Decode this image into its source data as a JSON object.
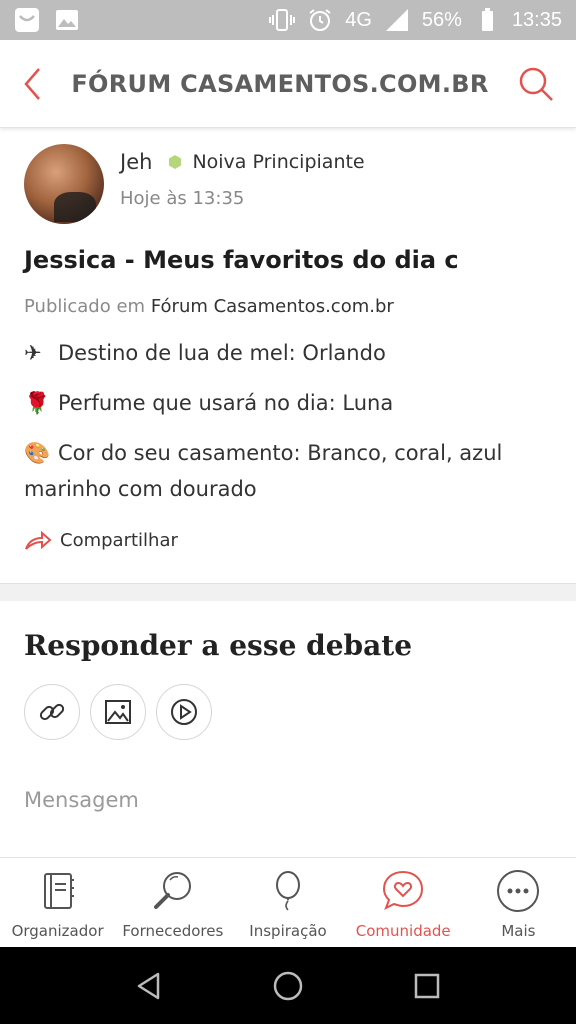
{
  "status_bar": {
    "network": "4G",
    "battery": "56%",
    "time": "13:35"
  },
  "header": {
    "title": "FÓRUM CASAMENTOS.COM.BR",
    "back_icon": "chevron-left-icon",
    "search_icon": "search-icon"
  },
  "post": {
    "author": "Jeh",
    "badge": "Noiva Principiante",
    "time": "Hoje às 13:35",
    "title": "Jessica - Meus favoritos do dia c",
    "published_prefix": "Publicado em",
    "published_forum": "Fórum Casamentos.com.br",
    "lines": [
      {
        "emoji": "✈",
        "text": "Destino de lua de mel: Orlando"
      },
      {
        "emoji": "🌹",
        "text": "Perfume que usará no dia: Luna"
      },
      {
        "emoji": "🎨",
        "text": "Cor do seu casamento: Branco, coral, azul marinho com dourado"
      }
    ],
    "share_label": "Compartilhar"
  },
  "reply": {
    "title": "Responder a esse debate",
    "tools": [
      "link-icon",
      "image-icon",
      "video-icon"
    ],
    "message_placeholder": "Mensagem"
  },
  "bottom_nav": {
    "items": [
      {
        "label": "Organizador",
        "icon": "notebook-icon",
        "active": false
      },
      {
        "label": "Fornecedores",
        "icon": "magnifier-icon",
        "active": false
      },
      {
        "label": "Inspiração",
        "icon": "balloon-icon",
        "active": false
      },
      {
        "label": "Comunidade",
        "icon": "chat-heart-icon",
        "active": true
      },
      {
        "label": "Mais",
        "icon": "more-icon",
        "active": false
      }
    ]
  },
  "colors": {
    "accent": "#e2534f",
    "badge_green": "#b5d67a"
  }
}
